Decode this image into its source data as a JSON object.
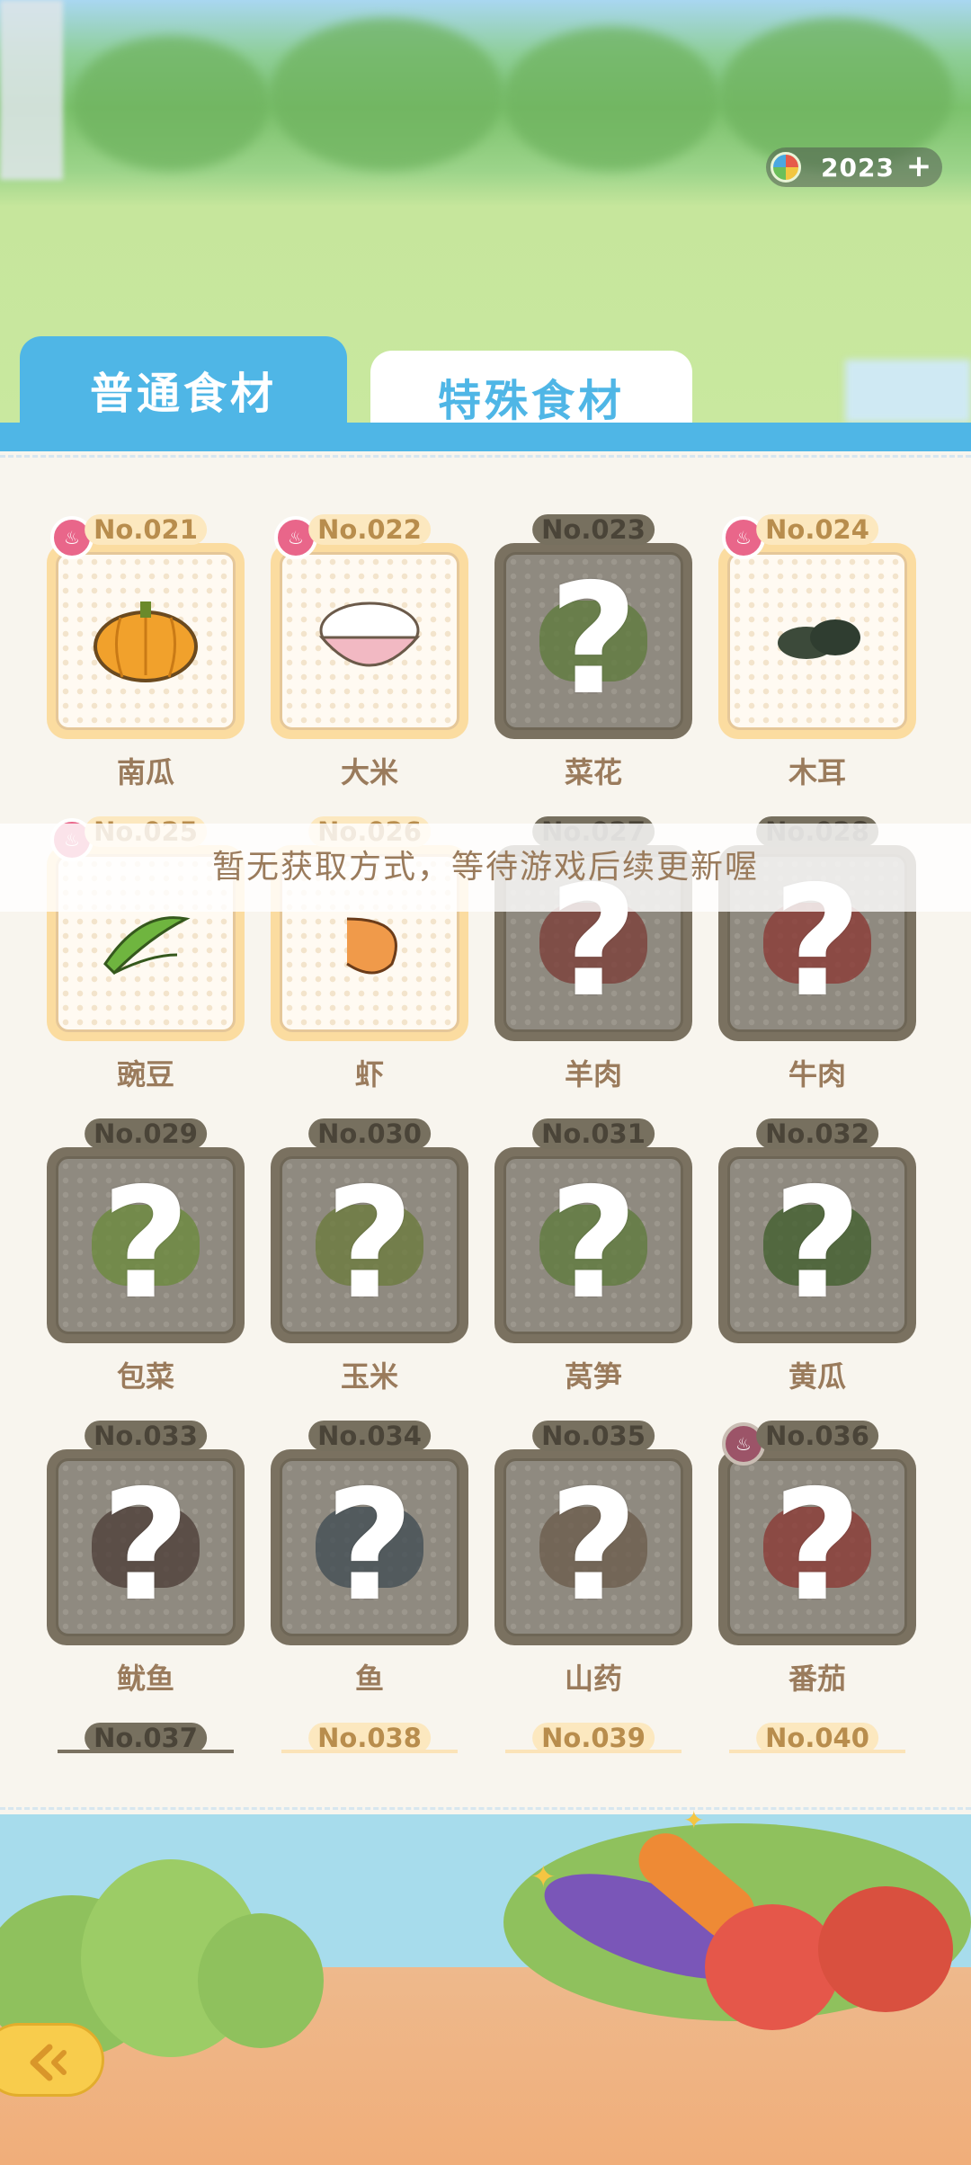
{
  "currency": {
    "value": "2023",
    "icon": "rainbow-coin-icon",
    "add_icon": "plus-icon"
  },
  "tabs": [
    {
      "label": "普通食材",
      "active": true
    },
    {
      "label": "特殊食材",
      "active": false
    }
  ],
  "toast": "暂无获取方式，等待游戏后续更新喔",
  "items": [
    {
      "no": "No.021",
      "name": "南瓜",
      "unlocked": true,
      "badge": true,
      "icon": "pumpkin-icon"
    },
    {
      "no": "No.022",
      "name": "大米",
      "unlocked": true,
      "badge": true,
      "icon": "rice-bowl-icon"
    },
    {
      "no": "No.023",
      "name": "菜花",
      "unlocked": false,
      "badge": false,
      "icon": "cauliflower-icon"
    },
    {
      "no": "No.024",
      "name": "木耳",
      "unlocked": true,
      "badge": true,
      "icon": "wood-ear-icon"
    },
    {
      "no": "No.025",
      "name": "豌豆",
      "unlocked": true,
      "badge": true,
      "icon": "pea-icon"
    },
    {
      "no": "No.026",
      "name": "虾",
      "unlocked": true,
      "badge": false,
      "icon": "shrimp-icon"
    },
    {
      "no": "No.027",
      "name": "羊肉",
      "unlocked": false,
      "badge": false,
      "icon": "mutton-icon"
    },
    {
      "no": "No.028",
      "name": "牛肉",
      "unlocked": false,
      "badge": false,
      "icon": "beef-icon"
    },
    {
      "no": "No.029",
      "name": "包菜",
      "unlocked": false,
      "badge": false,
      "icon": "cabbage-icon"
    },
    {
      "no": "No.030",
      "name": "玉米",
      "unlocked": false,
      "badge": false,
      "icon": "corn-icon"
    },
    {
      "no": "No.031",
      "name": "莴笋",
      "unlocked": false,
      "badge": false,
      "icon": "lettuce-stem-icon"
    },
    {
      "no": "No.032",
      "name": "黄瓜",
      "unlocked": false,
      "badge": false,
      "icon": "cucumber-icon"
    },
    {
      "no": "No.033",
      "name": "鱿鱼",
      "unlocked": false,
      "badge": false,
      "icon": "squid-icon"
    },
    {
      "no": "No.034",
      "name": "鱼",
      "unlocked": false,
      "badge": false,
      "icon": "fish-icon"
    },
    {
      "no": "No.035",
      "name": "山药",
      "unlocked": false,
      "badge": false,
      "icon": "yam-icon"
    },
    {
      "no": "No.036",
      "name": "番茄",
      "unlocked": false,
      "badge": true,
      "icon": "tomato-icon"
    }
  ],
  "partial_items": [
    {
      "no": "No.037",
      "unlocked": false
    },
    {
      "no": "No.038",
      "unlocked": true
    },
    {
      "no": "No.039",
      "unlocked": true
    },
    {
      "no": "No.040",
      "unlocked": true
    }
  ],
  "back_button": {
    "icon": "back-arrow-icon"
  }
}
